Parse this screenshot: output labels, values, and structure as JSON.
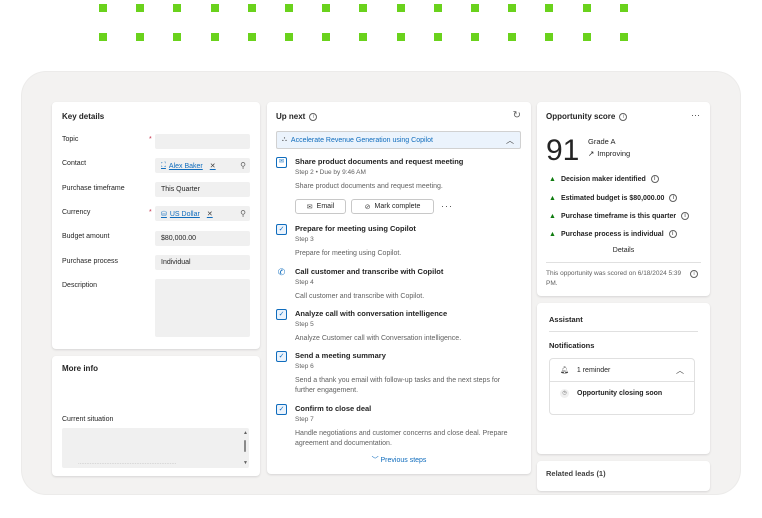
{
  "colors": {
    "accent": "#0f6cbd",
    "dot_green": "#6ad21c",
    "positive": "#107c10",
    "required": "#c4314b",
    "frame_bg": "#f3f2f1"
  },
  "key_details": {
    "title": "Key details",
    "fields": [
      {
        "label": "Topic",
        "value": "",
        "required": true
      },
      {
        "label": "Contact",
        "value": "Alex Baker",
        "type": "lookup",
        "icon": "contact-icon"
      },
      {
        "label": "Purchase timeframe",
        "value": "This Quarter"
      },
      {
        "label": "Currency",
        "value": "US Dollar",
        "required": true,
        "type": "lookup",
        "icon": "currency-icon"
      },
      {
        "label": "Budget amount",
        "value": "$80,000.00"
      },
      {
        "label": "Purchase process",
        "value": "Individual"
      },
      {
        "label": "Description",
        "value": ""
      }
    ],
    "required_mark": "*"
  },
  "more_info": {
    "title": "More info",
    "current_situation_label": "Current situation",
    "current_situation_text": "...........................................................",
    "scroll_up": "▲",
    "scroll_down": "▼"
  },
  "up_next": {
    "title": "Up next",
    "sequence_name": "Accelerate Revenue Generation using Copilot",
    "steps": [
      {
        "title": "Share product documents and request meeting",
        "sub": "Step 2 • Due by 9:46 AM",
        "desc": "Share product documents and request meeting.",
        "icon": "mail-icon"
      },
      {
        "title": "Prepare for meeting using Copilot",
        "sub": "Step 3",
        "desc": "Prepare for meeting using Copilot.",
        "icon": "task-check-icon"
      },
      {
        "title": "Call customer and transcribe with Copilot",
        "sub": "Step 4",
        "desc": "Call customer and transcribe with Copilot.",
        "icon": "phone-icon"
      },
      {
        "title": "Analyze call with conversation intelligence",
        "sub": "Step 5",
        "desc": "Analyze Customer call with Conversation intelligence.",
        "icon": "task-check-icon"
      },
      {
        "title": "Send a meeting summary",
        "sub": "Step 6",
        "desc": "Send a thank you email with follow-up tasks and the next steps for further engagement.",
        "icon": "task-check-icon"
      },
      {
        "title": "Confirm to close deal",
        "sub": "Step 7",
        "desc": "Handle negotiations and customer concerns and close deal. Prepare agreement and documentation.",
        "icon": "task-check-icon"
      }
    ],
    "email_button": "Email",
    "mark_complete_button": "Mark complete",
    "more": "···",
    "previous_steps": "Previous steps"
  },
  "opportunity_score": {
    "title": "Opportunity score",
    "score": "91",
    "grade": "Grade A",
    "trend": "Improving",
    "factors": [
      "Decision maker identified",
      "Estimated budget is $80,000.00",
      "Purchase timeframe is this quarter",
      "Purchase process is individual"
    ],
    "details_label": "Details",
    "scored_text": "This opportunity was scored on 6/18/2024 5:39 PM.",
    "more": "···"
  },
  "assistant": {
    "title": "Assistant",
    "notifications_label": "Notifications",
    "reminder_count": "1 reminder",
    "reminder_item": "Opportunity closing soon"
  },
  "related": {
    "title": "Related leads (1)"
  }
}
